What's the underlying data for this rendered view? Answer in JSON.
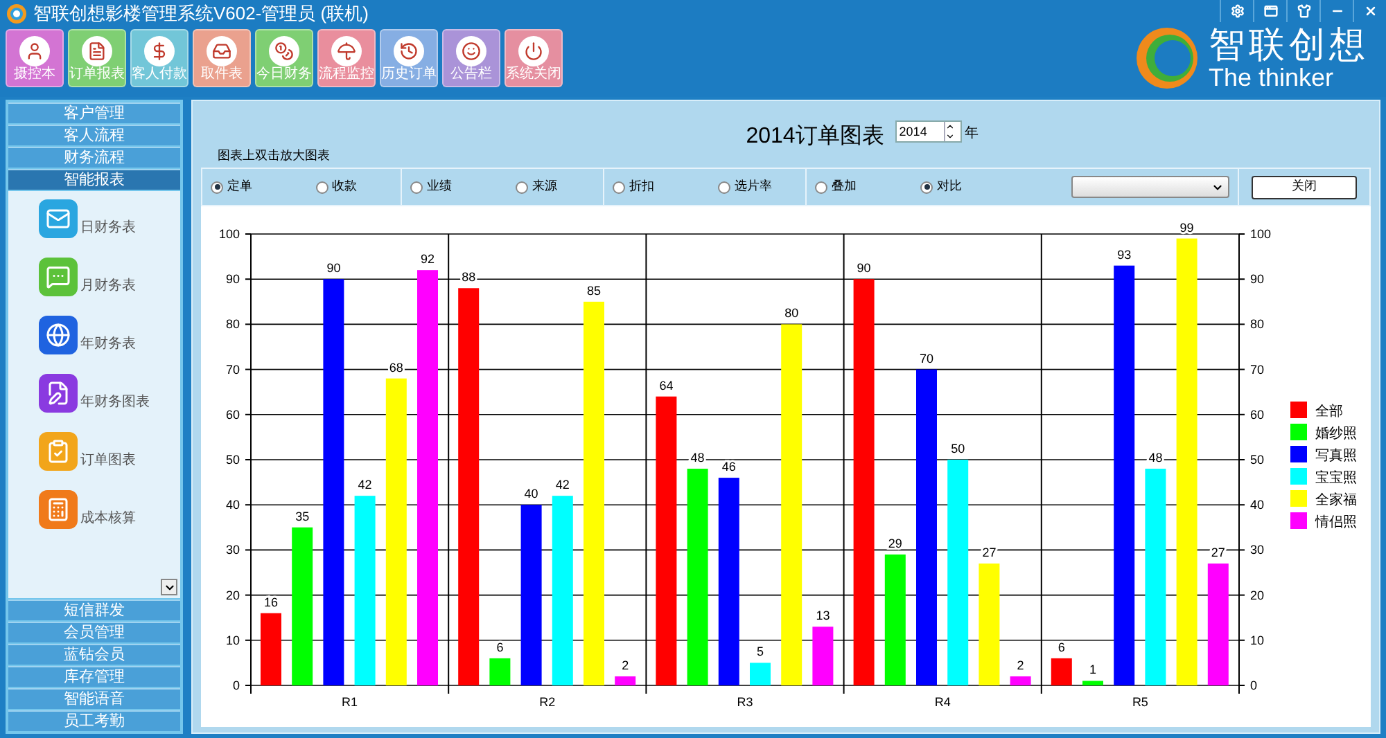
{
  "window": {
    "title": "智联创想影楼管理系统V602-管理员 (联机)"
  },
  "toolbar": [
    {
      "label": "摄控本",
      "color": "#d374d3"
    },
    {
      "label": "订单报表",
      "color": "#7fcf73"
    },
    {
      "label": "客人付款",
      "color": "#72c6d8"
    },
    {
      "label": "取件表",
      "color": "#eaa18e"
    },
    {
      "label": "今日财务",
      "color": "#7fcf73"
    },
    {
      "label": "流程监控",
      "color": "#e98e9d"
    },
    {
      "label": "历史订单",
      "color": "#86aee3"
    },
    {
      "label": "公告栏",
      "color": "#aa93d8"
    },
    {
      "label": "系统关闭",
      "color": "#e58fa0"
    }
  ],
  "logo": {
    "title": "智联创想",
    "subtitle": "The thinker"
  },
  "sidebar": {
    "items": [
      {
        "label": "客户管理",
        "expanded": false
      },
      {
        "label": "客人流程",
        "expanded": false
      },
      {
        "label": "财务流程",
        "expanded": false
      },
      {
        "label": "智能报表",
        "expanded": true,
        "children": [
          {
            "label": "日财务表"
          },
          {
            "label": "月财务表"
          },
          {
            "label": "年财务表"
          },
          {
            "label": "年财务图表"
          },
          {
            "label": "订单图表"
          },
          {
            "label": "成本核算"
          }
        ]
      },
      {
        "label": "短信群发",
        "expanded": false
      },
      {
        "label": "会员管理",
        "expanded": false
      },
      {
        "label": "蓝钻会员",
        "expanded": false
      },
      {
        "label": "库存管理",
        "expanded": false
      },
      {
        "label": "智能语音",
        "expanded": false
      },
      {
        "label": "员工考勤",
        "expanded": false
      }
    ]
  },
  "report": {
    "title": "2014订单图表",
    "year": "2014",
    "year_unit": "年",
    "hint": "图表上双击放大图表",
    "option_groups": [
      [
        {
          "label": "定单",
          "selected": true
        },
        {
          "label": "收款",
          "selected": false
        }
      ],
      [
        {
          "label": "业绩",
          "selected": false
        },
        {
          "label": "来源",
          "selected": false
        }
      ],
      [
        {
          "label": "折扣",
          "selected": false
        },
        {
          "label": "选片率",
          "selected": false
        }
      ],
      [
        {
          "label": "叠加",
          "selected": false
        },
        {
          "label": "对比",
          "selected": true
        }
      ]
    ],
    "close_button": "关闭",
    "chart_data": {
      "type": "bar",
      "categories": [
        "R1",
        "R2",
        "R3",
        "R4",
        "R5"
      ],
      "ylim": [
        0,
        100
      ],
      "yticks": [
        0,
        10,
        20,
        30,
        40,
        50,
        60,
        70,
        80,
        90,
        100
      ],
      "y2ticks": [
        0,
        10,
        20,
        30,
        40,
        50,
        60,
        70,
        80,
        90,
        100
      ],
      "y2lim": [
        0,
        100
      ],
      "grid": true,
      "legend": true,
      "data_labels": true,
      "series": [
        {
          "name": "全部",
          "color": "#ff0000",
          "values": [
            16,
            88,
            64,
            90,
            6
          ]
        },
        {
          "name": "婚纱照",
          "color": "#00ff00",
          "values": [
            35,
            6,
            48,
            29,
            1
          ]
        },
        {
          "name": "写真照",
          "color": "#0000ff",
          "values": [
            90,
            40,
            46,
            70,
            93
          ]
        },
        {
          "name": "宝宝照",
          "color": "#00ffff",
          "values": [
            42,
            42,
            5,
            50,
            48
          ]
        },
        {
          "name": "全家福",
          "color": "#ffff00",
          "values": [
            68,
            85,
            80,
            27,
            99
          ]
        },
        {
          "name": "情侣照",
          "color": "#ff00ff",
          "values": [
            92,
            2,
            13,
            2,
            27
          ]
        }
      ]
    }
  }
}
